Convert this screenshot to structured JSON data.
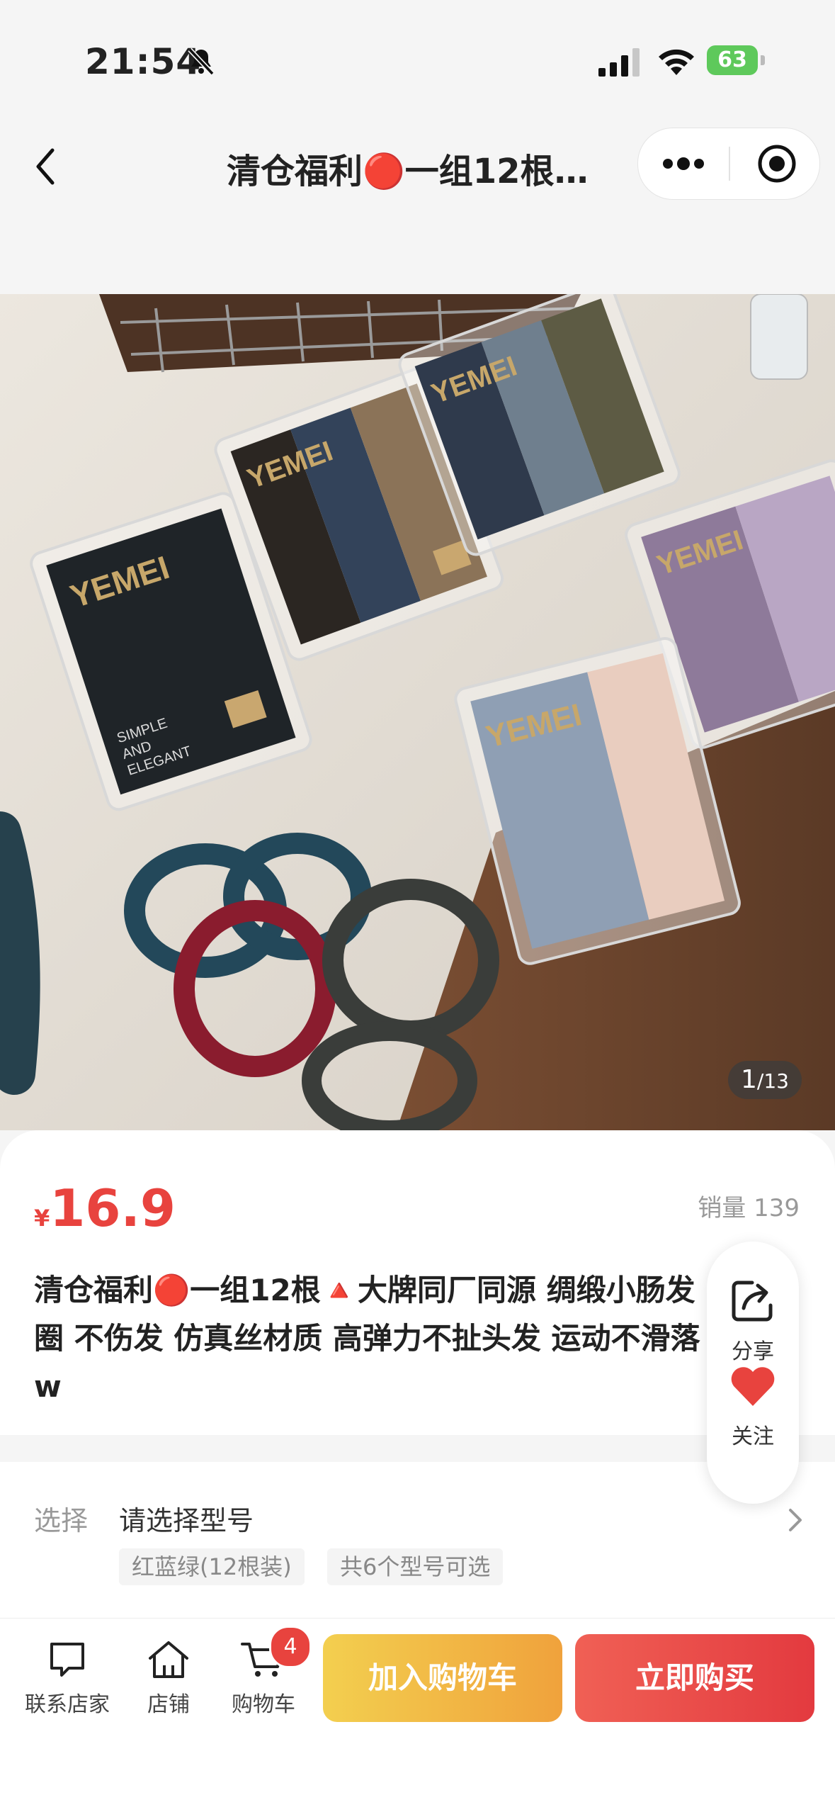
{
  "status_bar": {
    "time": "21:54",
    "battery": "63",
    "icons": [
      "bell-slash-icon",
      "signal-icon",
      "wifi-icon",
      "battery-charging-icon"
    ]
  },
  "nav": {
    "title": "清仓福利🔴一组12根…",
    "icons": [
      "back-icon",
      "more-icon",
      "target-icon"
    ]
  },
  "gallery": {
    "current": "1",
    "total": "/13",
    "image_text": {
      "brand": "YEMEI",
      "slogan": [
        "SIMPLE",
        "AND",
        "ELEGANT"
      ]
    }
  },
  "product": {
    "currency": "¥",
    "price": "16.9",
    "sales": "销量 139",
    "title": "清仓福利🔴一组12根🔺大牌同厂同源 绸缎小肠发圈 不伤发 仿真丝材质 高弹力不扯头发 运动不滑落w"
  },
  "floating": {
    "share_label": "分享",
    "follow_label": "关注",
    "icons": [
      "share-icon",
      "heart-icon"
    ]
  },
  "sku": {
    "label": "选择",
    "value": "请选择型号",
    "tags": [
      "红蓝绿(12根装)",
      "共6个型号可选"
    ]
  },
  "bottom_bar": {
    "contact_label": "联系店家",
    "shop_label": "店铺",
    "cart_label": "购物车",
    "cart_badge": "4",
    "add_to_cart": "加入购物车",
    "buy_now": "立即购买"
  },
  "colors": {
    "accent_red": "#e8433e",
    "cart_button": "#f0b33f",
    "buy_button": "#e8433e"
  }
}
